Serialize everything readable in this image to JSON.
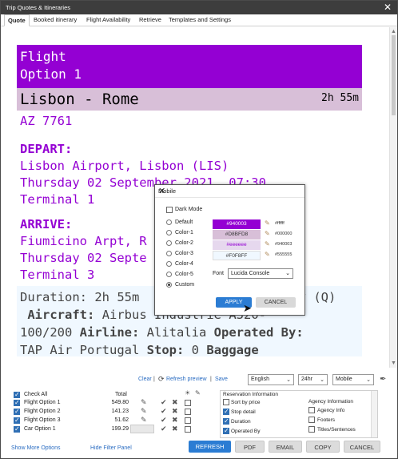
{
  "window": {
    "title": "Trip Quotes & Itineraries",
    "close": "✕"
  },
  "tabs": [
    "Quote",
    "Booked itinerary",
    "Flight Availability",
    "Retrieve",
    "Templates and Settings"
  ],
  "preview": {
    "flight_line1": "Flight",
    "flight_line2": "Option 1",
    "route": "Lisbon - Rome",
    "duration": "2h 55m",
    "flight_no": "AZ 7761",
    "depart_label": "DEPART:",
    "depart_airport": "Lisbon Airport, Lisbon (LIS)",
    "depart_date": "Thursday 02 September 2021, 07:30",
    "depart_terminal": "Terminal 1",
    "arrive_label": "ARRIVE:",
    "arrive_airport": "Fiumicino Arpt, R",
    "arrive_date": "Thursday 02 Septe",
    "arrive_terminal": "Terminal 3",
    "dur_line": "Duration: 2h 55m",
    "dur_line_tail": "omy (Q)",
    "aircraft_label": "Aircraft:",
    "aircraft_val": "Airbus Industrie A320-",
    "airline_prefix": "100/200",
    "airline_label": "Airline:",
    "airline_val": "Alitalia",
    "operated_label": "Operated By:",
    "operated_val": "TAP Air Portugal",
    "stop_label": "Stop:",
    "stop_val": "0",
    "baggage_label": "Baggage"
  },
  "modal": {
    "title": "Mobile",
    "dark_mode": "Dark Mode",
    "options": [
      "Default",
      "Color-1",
      "Color-2",
      "Color-3",
      "Color-4",
      "Color-5",
      "Custom"
    ],
    "selected": "Custom",
    "swatches": [
      {
        "label": "#940003",
        "color": "#9400d3",
        "text": "#ffffff",
        "hex": "#ffffff"
      },
      {
        "label": "#D8BFD8",
        "color": "#d8bfd8",
        "text": "#333333",
        "hex": "#000000"
      },
      {
        "label": "#eeeeee",
        "color": "#e6d8ee",
        "text": "#9400d3",
        "hex": "#940003"
      },
      {
        "label": "#F0F8FF",
        "color": "#f0f8ff",
        "text": "#333333",
        "hex": "#555555"
      }
    ],
    "font_label": "Font",
    "font_value": "Lucida Console",
    "apply": "APPLY",
    "cancel": "CANCEL"
  },
  "toolbar": {
    "clear": "Clear",
    "refresh_preview": "Refresh preview",
    "save": "Save",
    "language": "English",
    "time": "24hr",
    "device": "Mobile"
  },
  "grid": {
    "check_all": "Check All",
    "total": "Total",
    "rows": [
      {
        "name": "Flight Option 1",
        "total": "549.80"
      },
      {
        "name": "Flight Option 2",
        "total": "141.23"
      },
      {
        "name": "Flight Option 3",
        "total": "51.62"
      },
      {
        "name": "Car Option 1",
        "total": "199.29"
      }
    ]
  },
  "reservation": {
    "title": "Reservation Information",
    "items": [
      "Sort by price",
      "Stop detail",
      "Duration",
      "Operated By"
    ],
    "checked": [
      false,
      true,
      true,
      true
    ],
    "agency_title": "Agency Information",
    "agency_items": [
      "Agency Info",
      "Footers",
      "Titles/Sentences"
    ]
  },
  "footer": {
    "show_more": "Show More Options",
    "hide_filter": "Hide Filter Panel",
    "refresh": "REFRESH",
    "pdf": "PDF",
    "email": "EMAIL",
    "copy": "COPY",
    "cancel": "CANCEL"
  }
}
